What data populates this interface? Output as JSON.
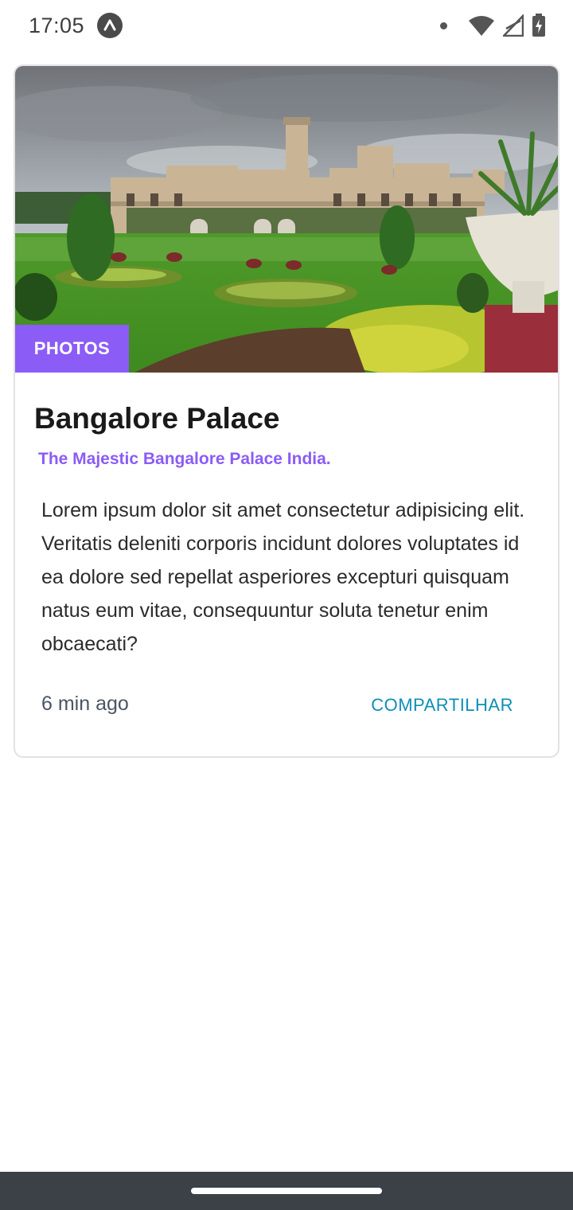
{
  "status_bar": {
    "time": "17:05",
    "app_icon": "arrow-up-icon",
    "icons": [
      "notification-dot-icon",
      "wifi-icon",
      "signal-icon",
      "battery-icon"
    ]
  },
  "card": {
    "image": "bangalore-palace-photo",
    "tag": "PHOTOS",
    "title": "Bangalore Palace",
    "subtitle": "The Majestic Bangalore Palace India.",
    "body": "Lorem ipsum dolor sit amet consectetur adipisicing elit. Veritatis deleniti corporis incidunt dolores voluptates id ea dolore sed repellat asperiores excepturi quisquam natus eum vitae, consequuntur soluta tenetur enim obcaecati?",
    "time_ago": "6 min ago",
    "share_label": "COMPARTILHAR"
  },
  "colors": {
    "accent": "#8b5cf6",
    "link": "#0e8fb5",
    "nav_bar": "#3c4148"
  }
}
